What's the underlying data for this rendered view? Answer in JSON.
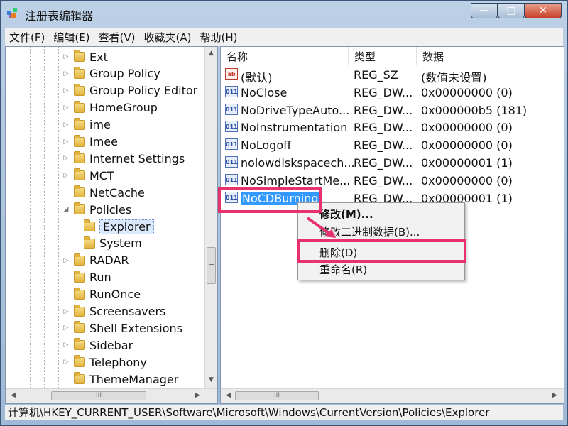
{
  "window": {
    "title": "注册表编辑器",
    "minimize": "—",
    "maximize": "□",
    "close": "✕"
  },
  "menu": [
    "文件(F)",
    "编辑(E)",
    "查看(V)",
    "收藏夹(A)",
    "帮助(H)"
  ],
  "tree": [
    {
      "label": "Ext",
      "expander": "▷"
    },
    {
      "label": "Group Policy",
      "expander": "▷"
    },
    {
      "label": "Group Policy Editor",
      "expander": "▷"
    },
    {
      "label": "HomeGroup",
      "expander": "▷"
    },
    {
      "label": "ime",
      "expander": "▷"
    },
    {
      "label": "Imee",
      "expander": "▷"
    },
    {
      "label": "Internet Settings",
      "expander": "▷"
    },
    {
      "label": "MCT",
      "expander": "▷"
    },
    {
      "label": "NetCache",
      "expander": ""
    },
    {
      "label": "Policies",
      "expander": "◢"
    },
    {
      "label": "Explorer",
      "expander": "",
      "selected": true
    },
    {
      "label": "System",
      "expander": ""
    },
    {
      "label": "RADAR",
      "expander": "▷"
    },
    {
      "label": "Run",
      "expander": ""
    },
    {
      "label": "RunOnce",
      "expander": ""
    },
    {
      "label": "Screensavers",
      "expander": "▷"
    },
    {
      "label": "Shell Extensions",
      "expander": "▷"
    },
    {
      "label": "Sidebar",
      "expander": "▷"
    },
    {
      "label": "Telephony",
      "expander": "▷"
    },
    {
      "label": "ThemeManager",
      "expander": ""
    }
  ],
  "columns": {
    "name": "名称",
    "type": "类型",
    "data": "数据"
  },
  "values": [
    {
      "name": "(默认)",
      "type": "REG_SZ",
      "data": "(数值未设置)",
      "icon": "ab"
    },
    {
      "name": "NoClose",
      "type": "REG_DW...",
      "data": "0x00000000 (0)",
      "icon": "011"
    },
    {
      "name": "NoDriveTypeAuto...",
      "type": "REG_DW...",
      "data": "0x000000b5 (181)",
      "icon": "011"
    },
    {
      "name": "NoInstrumentation",
      "type": "REG_DW...",
      "data": "0x00000000 (0)",
      "icon": "011"
    },
    {
      "name": "NoLogoff",
      "type": "REG_DW...",
      "data": "0x00000000 (0)",
      "icon": "011"
    },
    {
      "name": "nolowdiskspacech...",
      "type": "REG_DW...",
      "data": "0x00000001 (1)",
      "icon": "011"
    },
    {
      "name": "NoSimpleStartMe...",
      "type": "REG_DW...",
      "data": "0x00000000 (0)",
      "icon": "011"
    },
    {
      "name": "NoCDBurning",
      "type": "REG_DW...",
      "data": "0x00000001 (1)",
      "icon": "011",
      "selected": true
    }
  ],
  "context_menu": {
    "modify": "修改(M)...",
    "modify_binary": "修改二进制数据(B)...",
    "delete": "删除(D)",
    "rename": "重命名(R)"
  },
  "scroll": {
    "up": "▲",
    "down": "▼",
    "left": "◀",
    "right": "▶",
    "grip": "≡",
    "hgrip": "III"
  },
  "status_path": "计算机\\HKEY_CURRENT_USER\\Software\\Microsoft\\Windows\\CurrentVersion\\Policies\\Explorer",
  "colors": {
    "highlight": "#e8326e",
    "selection": "#3399ff"
  }
}
